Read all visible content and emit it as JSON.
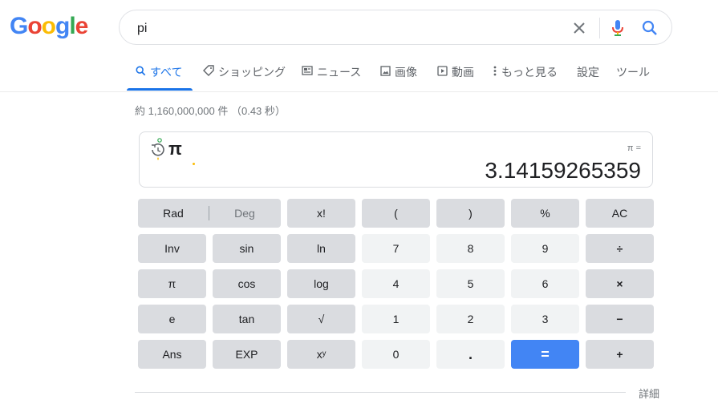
{
  "logo": {
    "letters": [
      "G",
      "o",
      "o",
      "g",
      "l",
      "e"
    ],
    "colors": [
      "#4285f4",
      "#ea4335",
      "#fbbc05",
      "#4285f4",
      "#34a853",
      "#ea4335"
    ]
  },
  "search": {
    "value": "pi",
    "clear_icon": "close-icon",
    "voice_icon": "microphone-icon",
    "search_icon": "search-icon"
  },
  "tabs": [
    {
      "label": "すべて",
      "icon": "search-icon",
      "active": true
    },
    {
      "label": "ショッピング",
      "icon": "tag-icon"
    },
    {
      "label": "ニュース",
      "icon": "news-icon"
    },
    {
      "label": "画像",
      "icon": "image-icon"
    },
    {
      "label": "動画",
      "icon": "video-icon"
    },
    {
      "label": "もっと見る",
      "icon": "more-vert-icon"
    },
    {
      "label": "設定"
    },
    {
      "label": "ツール"
    }
  ],
  "stats": "約 1,160,000,000 件 （0.43 秒）",
  "calculator": {
    "history_symbol": "π",
    "expression": "π =",
    "result": "3.14159265359",
    "mode": {
      "rad": "Rad",
      "deg": "Deg",
      "selected": "Rad"
    },
    "keys": [
      [
        "x!",
        "(",
        ")",
        "%",
        "AC"
      ],
      [
        "Inv",
        "sin",
        "ln",
        "7",
        "8",
        "9",
        "÷"
      ],
      [
        "π",
        "cos",
        "log",
        "4",
        "5",
        "6",
        "×"
      ],
      [
        "e",
        "tan",
        "√",
        "1",
        "2",
        "3",
        "−"
      ],
      [
        "Ans",
        "EXP",
        "xʸ",
        "0",
        ".",
        "=",
        "+"
      ]
    ]
  },
  "footer": {
    "more": "詳細"
  },
  "colors": {
    "accent": "#1a73e8",
    "equals": "#4285f4",
    "fn_key": "#dadce0",
    "num_key": "#f1f3f4"
  }
}
